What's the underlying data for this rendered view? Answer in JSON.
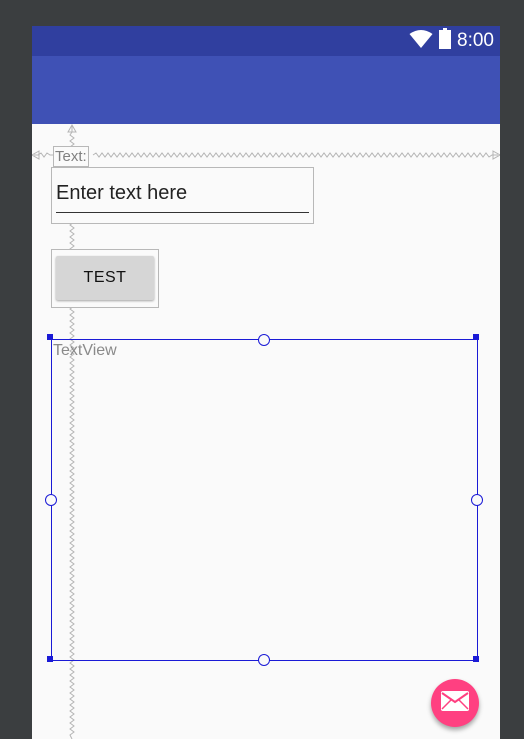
{
  "status_bar": {
    "time": "8:00",
    "icons": [
      "wifi-icon",
      "battery-icon"
    ]
  },
  "form": {
    "label_text": "Text:",
    "input_value": "Enter text here",
    "button_label": "TEST",
    "textview_text": "TextView"
  },
  "fab": {
    "icon": "email-icon"
  },
  "colors": {
    "background": "#3b3e40",
    "status_bar": "#303f9f",
    "app_bar": "#3f51b5",
    "accent": "#ff4081",
    "selection": "#1a1ad6"
  }
}
